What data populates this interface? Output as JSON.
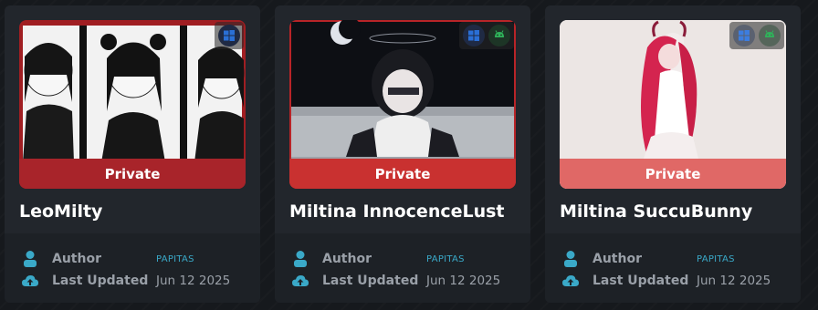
{
  "cards": [
    {
      "title": "LeoMilty",
      "visibility": "Private",
      "platforms": [
        "windows-icon"
      ],
      "author_label": "Author",
      "author": "PAPITAS",
      "updated_label": "Last Updated",
      "updated": "Jun 12 2025",
      "privbar_color": "#b3242a"
    },
    {
      "title": "Miltina InnocenceLust",
      "visibility": "Private",
      "platforms": [
        "windows-icon",
        "android-icon"
      ],
      "author_label": "Author",
      "author": "PAPITAS",
      "updated_label": "Last Updated",
      "updated": "Jun 12 2025",
      "privbar_color": "#c9302f"
    },
    {
      "title": "Miltina SuccuBunny",
      "visibility": "Private",
      "platforms": [
        "windows-icon",
        "android-icon"
      ],
      "author_label": "Author",
      "author": "PAPITAS",
      "updated_label": "Last Updated",
      "updated": "Jun 12 2025",
      "privbar_color": "#e06a68"
    }
  ],
  "colors": {
    "windows": "#2a6fd6",
    "android": "#2fb35a",
    "accent": "#3aa9c8"
  }
}
